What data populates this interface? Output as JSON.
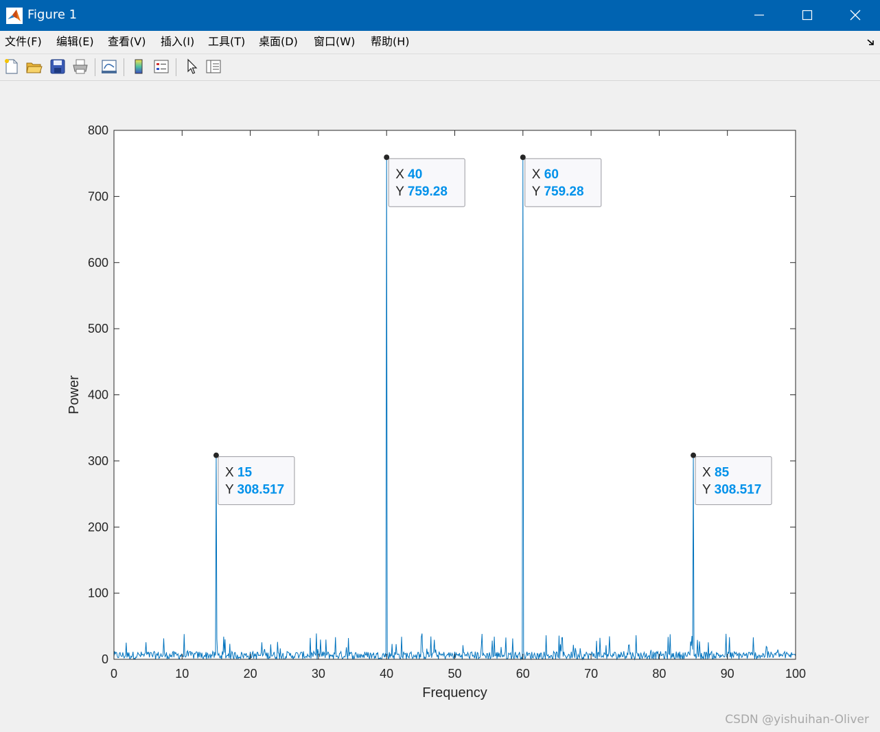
{
  "window": {
    "title": "Figure 1"
  },
  "menu": [
    "文件(F)",
    "编辑(E)",
    "查看(V)",
    "插入(I)",
    "工具(T)",
    "桌面(D)",
    "窗口(W)",
    "帮助(H)"
  ],
  "toolbar": {
    "icons": [
      "new-figure-icon",
      "open-file-icon",
      "save-icon",
      "print-icon",
      "link-plot-icon",
      "insert-colorbar-icon",
      "insert-legend-icon",
      "edit-plot-icon",
      "property-inspector-icon"
    ]
  },
  "colors": {
    "titlebar": "#0063b1",
    "line": "#0072bd",
    "datatip_value": "#0091ea",
    "figure_bg": "#f0f0f0"
  },
  "chart_data": {
    "type": "line",
    "xlabel": "Frequency",
    "ylabel": "Power",
    "xlim": [
      0,
      100
    ],
    "ylim": [
      0,
      800
    ],
    "xticks": [
      0,
      10,
      20,
      30,
      40,
      50,
      60,
      70,
      80,
      90,
      100
    ],
    "yticks": [
      0,
      100,
      200,
      300,
      400,
      500,
      600,
      700,
      800
    ],
    "grid": false,
    "peaks": [
      {
        "x": 15,
        "y": 308.517
      },
      {
        "x": 40,
        "y": 759.28
      },
      {
        "x": 60,
        "y": 759.28
      },
      {
        "x": 85,
        "y": 308.517
      }
    ],
    "noise_floor_max": 40,
    "datatips": [
      {
        "x_label": "X",
        "x_value": "15",
        "y_label": "Y",
        "y_value": "308.517"
      },
      {
        "x_label": "X",
        "x_value": "40",
        "y_label": "Y",
        "y_value": "759.28"
      },
      {
        "x_label": "X",
        "x_value": "60",
        "y_label": "Y",
        "y_value": "759.28"
      },
      {
        "x_label": "X",
        "x_value": "85",
        "y_label": "Y",
        "y_value": "308.517"
      }
    ]
  },
  "watermark": "CSDN @yishuihan-Oliver"
}
